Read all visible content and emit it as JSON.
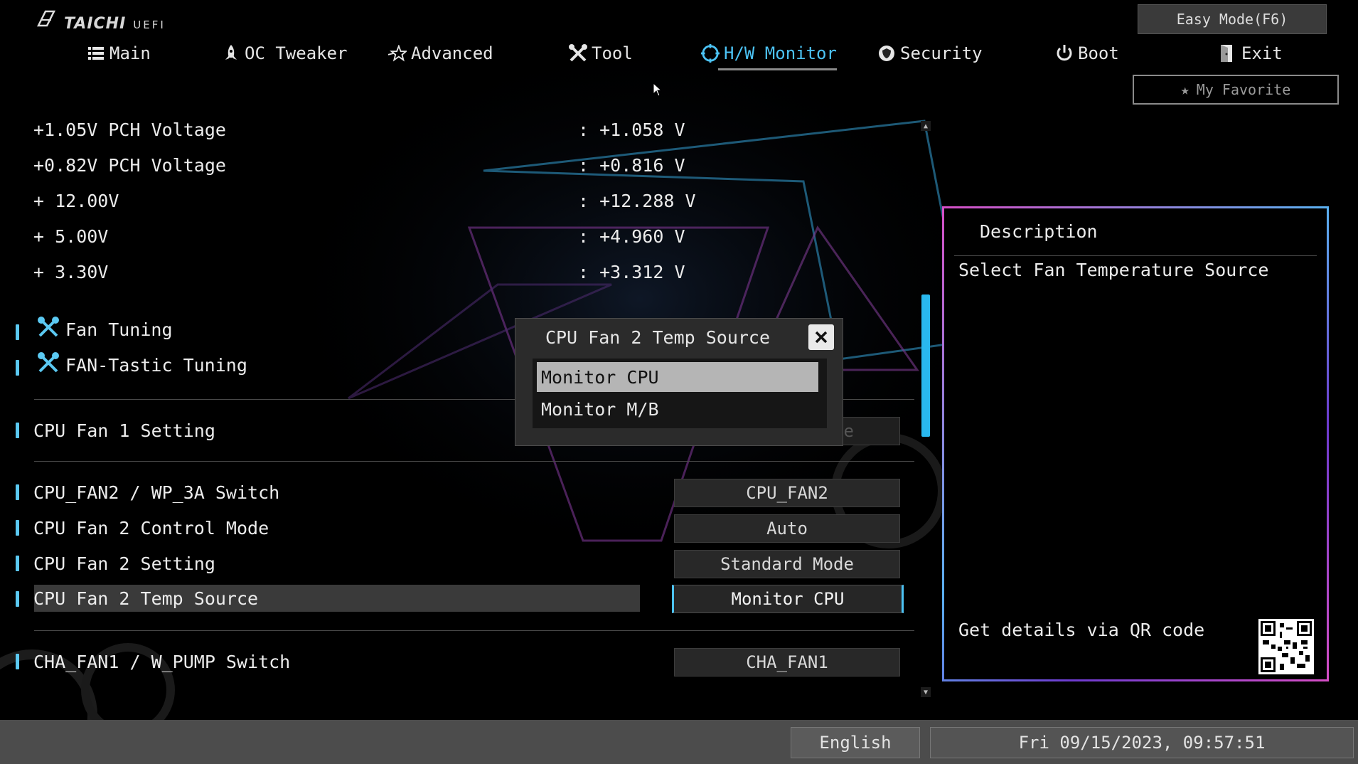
{
  "header": {
    "brand": "TAICHI",
    "uefi": "UEFI",
    "easy_mode": "Easy Mode(F6)",
    "my_favorite": "My Favorite"
  },
  "tabs": [
    {
      "label": "Main",
      "icon": "list-icon"
    },
    {
      "label": "OC Tweaker",
      "icon": "rocket-icon"
    },
    {
      "label": "Advanced",
      "icon": "star-icon"
    },
    {
      "label": "Tool",
      "icon": "tools-icon"
    },
    {
      "label": "H/W Monitor",
      "icon": "monitor-icon",
      "active": true
    },
    {
      "label": "Security",
      "icon": "shield-icon"
    },
    {
      "label": "Boot",
      "icon": "power-icon"
    },
    {
      "label": "Exit",
      "icon": "exit-icon"
    }
  ],
  "voltages": [
    {
      "label": "+1.05V PCH Voltage",
      "value": ": +1.058 V"
    },
    {
      "label": "+0.82V PCH Voltage",
      "value": ": +0.816 V"
    },
    {
      "label": "+ 12.00V",
      "value": ": +12.288 V"
    },
    {
      "label": "+ 5.00V",
      "value": ": +4.960 V"
    },
    {
      "label": "+ 3.30V",
      "value": ": +3.312 V"
    }
  ],
  "tuning": [
    {
      "label": "Fan Tuning"
    },
    {
      "label": "FAN-Tastic Tuning"
    }
  ],
  "settings": {
    "cpu_fan1": {
      "label": "CPU Fan 1 Setting",
      "value": "Standard Mode"
    },
    "fan2_switch": {
      "label": "CPU_FAN2 / WP_3A Switch",
      "value": "CPU_FAN2"
    },
    "fan2_control": {
      "label": "CPU Fan 2 Control Mode",
      "value": "Auto"
    },
    "fan2_setting": {
      "label": "CPU Fan 2 Setting",
      "value": "Standard Mode"
    },
    "fan2_temp": {
      "label": "CPU Fan 2 Temp Source",
      "value": "Monitor CPU"
    },
    "cha_fan1": {
      "label": "CHA_FAN1 / W_PUMP Switch",
      "value": "CHA_FAN1"
    }
  },
  "description": {
    "title": "Description",
    "text": "Select Fan Temperature Source",
    "qr_text": "Get details via QR code"
  },
  "popup": {
    "title": "CPU Fan 2 Temp Source",
    "options": [
      "Monitor CPU",
      "Monitor M/B"
    ],
    "selected": 0
  },
  "footer": {
    "language": "English",
    "datetime": "Fri 09/15/2023, 09:57:51"
  },
  "colors": {
    "accent": "#4cc3f5",
    "scrollbar": "#29b8ef",
    "selected_row": "#3a3a3a",
    "panel_border_pink": "#d64ec6"
  }
}
